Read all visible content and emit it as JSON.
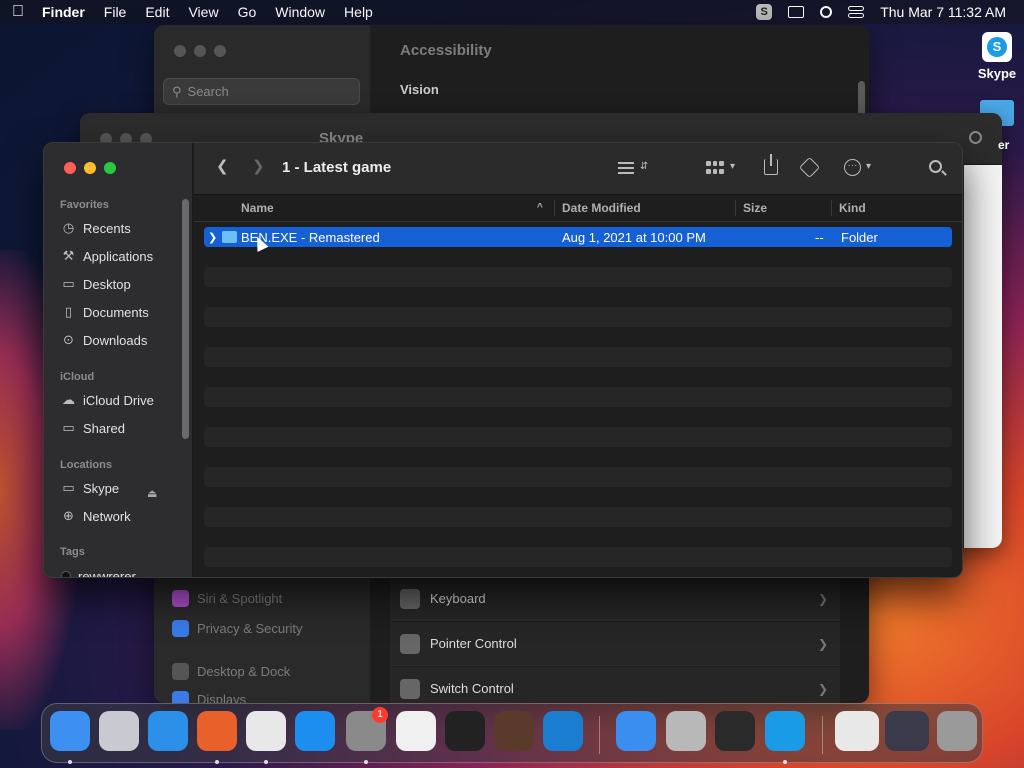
{
  "menubar": {
    "app": "Finder",
    "items": [
      "File",
      "Edit",
      "View",
      "Go",
      "Window",
      "Help"
    ],
    "clock": "Thu Mar 7  11:32 AM",
    "skype_icon_letter": "S"
  },
  "desktop": {
    "skype_label": "Skype",
    "folder_label": "er"
  },
  "settings": {
    "title": "Accessibility",
    "search_placeholder": "Search",
    "vision_label": "Vision",
    "sidebar": [
      {
        "label": "Siri & Spotlight",
        "color": "#b04fd0"
      },
      {
        "label": "Privacy & Security",
        "color": "#3a7be8"
      },
      {
        "label": "Desktop & Dock",
        "color": "#555555"
      },
      {
        "label": "Displays",
        "color": "#3a7be8"
      }
    ],
    "rows": [
      {
        "label": "Keyboard"
      },
      {
        "label": "Pointer Control"
      },
      {
        "label": "Switch Control"
      }
    ]
  },
  "finder_back": {
    "title": "Skype"
  },
  "finder": {
    "title": "1 - Latest game",
    "sections": {
      "favorites": "Favorites",
      "icloud": "iCloud",
      "locations": "Locations",
      "tags": "Tags"
    },
    "favorites": [
      {
        "label": "Recents",
        "glyph": "◷"
      },
      {
        "label": "Applications",
        "glyph": "⚒"
      },
      {
        "label": "Desktop",
        "glyph": "▭"
      },
      {
        "label": "Documents",
        "glyph": "▯"
      },
      {
        "label": "Downloads",
        "glyph": "⊙"
      }
    ],
    "icloud": [
      {
        "label": "iCloud Drive",
        "glyph": "☁"
      },
      {
        "label": "Shared",
        "glyph": "▭"
      }
    ],
    "locations": [
      {
        "label": "Skype",
        "glyph": "▭"
      },
      {
        "label": "Network",
        "glyph": "⊕"
      }
    ],
    "tags": [
      {
        "label": "rewwrerer"
      }
    ],
    "columns": {
      "name": "Name",
      "date": "Date Modified",
      "size": "Size",
      "kind": "Kind"
    },
    "files": [
      {
        "name": "BEN.EXE - Remastered",
        "date": "Aug 1, 2021 at 10:00 PM",
        "size": "--",
        "kind": "Folder"
      }
    ]
  },
  "dock": {
    "apps": [
      {
        "name": "Finder",
        "color": "#3d8ff0"
      },
      {
        "name": "Launchpad",
        "color": "#c9c9d2"
      },
      {
        "name": "Safari",
        "color": "#2c8fe8"
      },
      {
        "name": "Firefox",
        "color": "#e8602a"
      },
      {
        "name": "Chrome",
        "color": "#e8e8e8"
      },
      {
        "name": "App Store",
        "color": "#1c8ef0"
      },
      {
        "name": "System Settings",
        "color": "#8a8a8a",
        "badge": "1"
      },
      {
        "name": "TextEdit",
        "color": "#f0f0f0"
      },
      {
        "name": "Terminal",
        "color": "#222222"
      },
      {
        "name": "GarageBand",
        "color": "#5a3a2a"
      },
      {
        "name": "Visual Studio Code",
        "color": "#1a7dd0"
      },
      {
        "name": "Weather",
        "color": "#3a8ef0"
      },
      {
        "name": "Utility",
        "color": "#b8b8b8"
      },
      {
        "name": "Unity",
        "color": "#2a2a2a"
      },
      {
        "name": "Skype",
        "color": "#1a9be6"
      },
      {
        "name": "Preview",
        "color": "#e8e8e8"
      },
      {
        "name": "Downloads",
        "color": "#3a3a4a"
      },
      {
        "name": "Trash",
        "color": "#9a9a9a"
      }
    ]
  }
}
